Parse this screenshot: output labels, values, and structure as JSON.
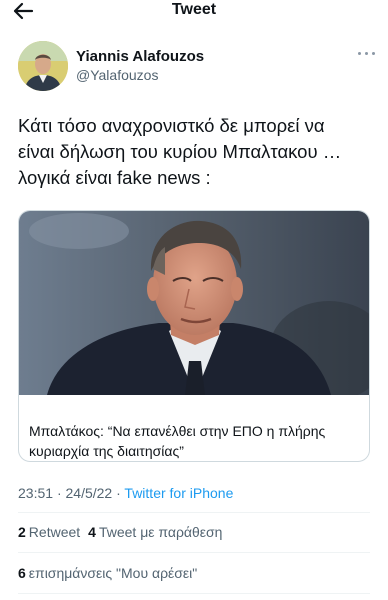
{
  "header": {
    "title": "Tweet",
    "back_icon": "arrow-left-icon"
  },
  "author": {
    "name": "Yiannis Alafouzos",
    "handle": "@Yalafouzos",
    "more_icon": "more-horizontal-icon"
  },
  "tweet": {
    "lines": [
      "Κάτι τόσο αναχρονιστκό δε μπορεί να",
      "είναι δήλωση του κυρίου Μπαλτακου …",
      "λογικά είναι fake news :"
    ]
  },
  "card": {
    "caption": "Μπαλτάκος: “Να επανέλθει στην ΕΠΟ η πλήρης κυριαρχία της διαιτησίας”"
  },
  "meta": {
    "time": "23:51",
    "separator": "·",
    "date": "24/5/22",
    "source": "Twitter for iPhone"
  },
  "stats": {
    "retweets": "2",
    "retweets_label": "Retweet",
    "quotes": "4",
    "quotes_label": "Tweet με παράθεση",
    "likes": "6",
    "likes_label": "επισημάνσεις \"Μου αρέσει\""
  },
  "colors": {
    "link": "#1d9bf0",
    "secondary_text": "#536471",
    "divider": "#eff3f4"
  }
}
